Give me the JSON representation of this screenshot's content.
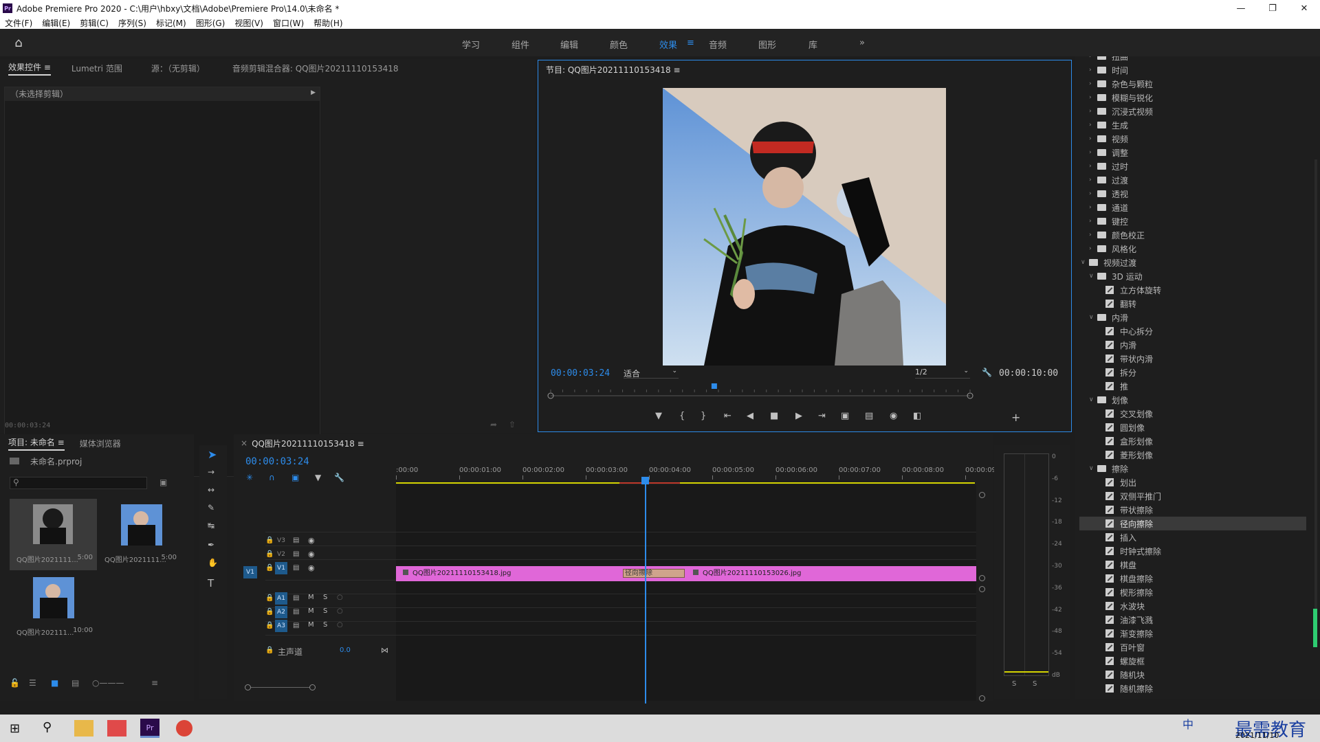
{
  "window": {
    "title": "Adobe Premiere Pro 2020 - C:\\用户\\hbxy\\文档\\Adobe\\Premiere Pro\\14.0\\未命名 *",
    "logo": "Pr"
  },
  "menu": [
    "文件(F)",
    "编辑(E)",
    "剪辑(C)",
    "序列(S)",
    "标记(M)",
    "图形(G)",
    "视图(V)",
    "窗口(W)",
    "帮助(H)"
  ],
  "workspaces": [
    "学习",
    "组件",
    "编辑",
    "颜色",
    "效果",
    "音频",
    "图形",
    "库"
  ],
  "active_workspace": "效果",
  "source_panel": {
    "tabs": [
      "效果控件",
      "Lumetri 范围",
      "源：（无剪辑）",
      "音频剪辑混合器: QQ图片20211110153418"
    ],
    "no_clip": "（未选择剪辑）",
    "timecode": "00:00:03:24"
  },
  "program": {
    "title": "节目: QQ图片20211110153418",
    "timecode": "00:00:03:24",
    "fit": "适合",
    "resolution": "1/2",
    "duration": "00:00:10:00",
    "playhead_fraction": 0.39
  },
  "project": {
    "tabs": [
      "项目: 未命名",
      "媒体浏览器"
    ],
    "file": "未命名.prproj",
    "items": [
      {
        "name": "QQ图片2021111...",
        "dur": "5:00"
      },
      {
        "name": "QQ图片2021111...",
        "dur": "5:00"
      },
      {
        "name": "QQ图片202111...",
        "dur": "10:00"
      }
    ]
  },
  "timeline": {
    "tab": "QQ图片20211110153418",
    "timecode": "00:00:03:24",
    "ruler": [
      ":00:00",
      "00:00:01:00",
      "00:00:02:00",
      "00:00:03:00",
      "00:00:04:00",
      "00:00:05:00",
      "00:00:06:00",
      "00:00:07:00",
      "00:00:08:00",
      "00:00:09:"
    ],
    "video_tracks": [
      "V3",
      "V2",
      "V1"
    ],
    "audio_tracks": [
      "A1",
      "A2",
      "A3"
    ],
    "src_v1": "V1",
    "master": "主声道",
    "master_val": "0.0",
    "clip1": "QQ图片20211110153418.jpg",
    "transition": "径向擦除",
    "clip2": "QQ图片20211110153026.jpg",
    "m": "M",
    "s": "S"
  },
  "meter": {
    "scale": [
      "0",
      "-6",
      "-12",
      "-18",
      "-24",
      "-30",
      "-36",
      "-42",
      "-48",
      "-54",
      "dB"
    ],
    "solo": "S"
  },
  "effects": [
    {
      "lvl": 1,
      "type": "folder",
      "label": "扭曲",
      "open": false
    },
    {
      "lvl": 1,
      "type": "folder",
      "label": "时间",
      "open": false
    },
    {
      "lvl": 1,
      "type": "folder",
      "label": "杂色与颗粒",
      "open": false
    },
    {
      "lvl": 1,
      "type": "folder",
      "label": "模糊与锐化",
      "open": false
    },
    {
      "lvl": 1,
      "type": "folder",
      "label": "沉浸式视频",
      "open": false
    },
    {
      "lvl": 1,
      "type": "folder",
      "label": "生成",
      "open": false
    },
    {
      "lvl": 1,
      "type": "folder",
      "label": "视频",
      "open": false
    },
    {
      "lvl": 1,
      "type": "folder",
      "label": "调整",
      "open": false
    },
    {
      "lvl": 1,
      "type": "folder",
      "label": "过时",
      "open": false
    },
    {
      "lvl": 1,
      "type": "folder",
      "label": "过渡",
      "open": false
    },
    {
      "lvl": 1,
      "type": "folder",
      "label": "透视",
      "open": false
    },
    {
      "lvl": 1,
      "type": "folder",
      "label": "通道",
      "open": false
    },
    {
      "lvl": 1,
      "type": "folder",
      "label": "键控",
      "open": false
    },
    {
      "lvl": 1,
      "type": "folder",
      "label": "颜色校正",
      "open": false
    },
    {
      "lvl": 1,
      "type": "folder",
      "label": "风格化",
      "open": false
    },
    {
      "lvl": 0,
      "type": "folder",
      "label": "视频过渡",
      "open": true
    },
    {
      "lvl": 1,
      "type": "folder",
      "label": "3D 运动",
      "open": true
    },
    {
      "lvl": 2,
      "type": "fx",
      "label": "立方体旋转"
    },
    {
      "lvl": 2,
      "type": "fx",
      "label": "翻转"
    },
    {
      "lvl": 1,
      "type": "folder",
      "label": "内滑",
      "open": true
    },
    {
      "lvl": 2,
      "type": "fx",
      "label": "中心拆分"
    },
    {
      "lvl": 2,
      "type": "fx",
      "label": "内滑"
    },
    {
      "lvl": 2,
      "type": "fx",
      "label": "带状内滑"
    },
    {
      "lvl": 2,
      "type": "fx",
      "label": "拆分"
    },
    {
      "lvl": 2,
      "type": "fx",
      "label": "推"
    },
    {
      "lvl": 1,
      "type": "folder",
      "label": "划像",
      "open": true
    },
    {
      "lvl": 2,
      "type": "fx",
      "label": "交叉划像"
    },
    {
      "lvl": 2,
      "type": "fx",
      "label": "圆划像"
    },
    {
      "lvl": 2,
      "type": "fx",
      "label": "盒形划像"
    },
    {
      "lvl": 2,
      "type": "fx",
      "label": "菱形划像"
    },
    {
      "lvl": 1,
      "type": "folder",
      "label": "擦除",
      "open": true
    },
    {
      "lvl": 2,
      "type": "fx",
      "label": "划出"
    },
    {
      "lvl": 2,
      "type": "fx",
      "label": "双侧平推门"
    },
    {
      "lvl": 2,
      "type": "fx",
      "label": "带状擦除"
    },
    {
      "lvl": 2,
      "type": "fx",
      "label": "径向擦除",
      "selected": true
    },
    {
      "lvl": 2,
      "type": "fx",
      "label": "插入"
    },
    {
      "lvl": 2,
      "type": "fx",
      "label": "时钟式擦除"
    },
    {
      "lvl": 2,
      "type": "fx",
      "label": "棋盘"
    },
    {
      "lvl": 2,
      "type": "fx",
      "label": "棋盘擦除"
    },
    {
      "lvl": 2,
      "type": "fx",
      "label": "楔形擦除"
    },
    {
      "lvl": 2,
      "type": "fx",
      "label": "水波块"
    },
    {
      "lvl": 2,
      "type": "fx",
      "label": "油漆飞溅"
    },
    {
      "lvl": 2,
      "type": "fx",
      "label": "渐变擦除"
    },
    {
      "lvl": 2,
      "type": "fx",
      "label": "百叶窗"
    },
    {
      "lvl": 2,
      "type": "fx",
      "label": "螺旋框"
    },
    {
      "lvl": 2,
      "type": "fx",
      "label": "随机块"
    },
    {
      "lvl": 2,
      "type": "fx",
      "label": "随机擦除"
    }
  ],
  "taskbar": {
    "date": "2021/11/10",
    "watermark": "最需教育",
    "ime": "中"
  }
}
